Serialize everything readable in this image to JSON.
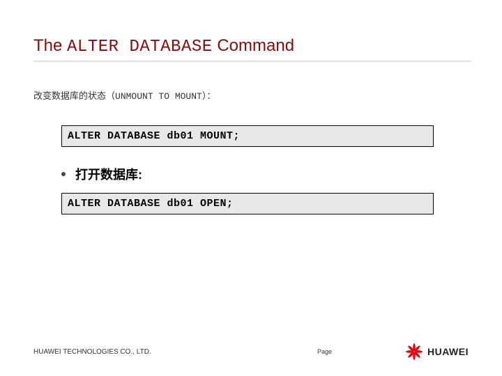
{
  "title": {
    "pre": "The ",
    "mono": "ALTER DATABASE",
    "post": " Command"
  },
  "subtitle": {
    "pre": "改变数据库的状态（",
    "mono": "UNMOUNT TO MOUNT",
    "post": "）："
  },
  "code1": "ALTER DATABASE db01 MOUNT;",
  "bullet": "打开数据库:",
  "code2": "ALTER DATABASE db01 OPEN;",
  "footer": {
    "company": "HUAWEI TECHNOLOGIES CO., LTD.",
    "page": "Page",
    "brand": "HUAWEI"
  }
}
